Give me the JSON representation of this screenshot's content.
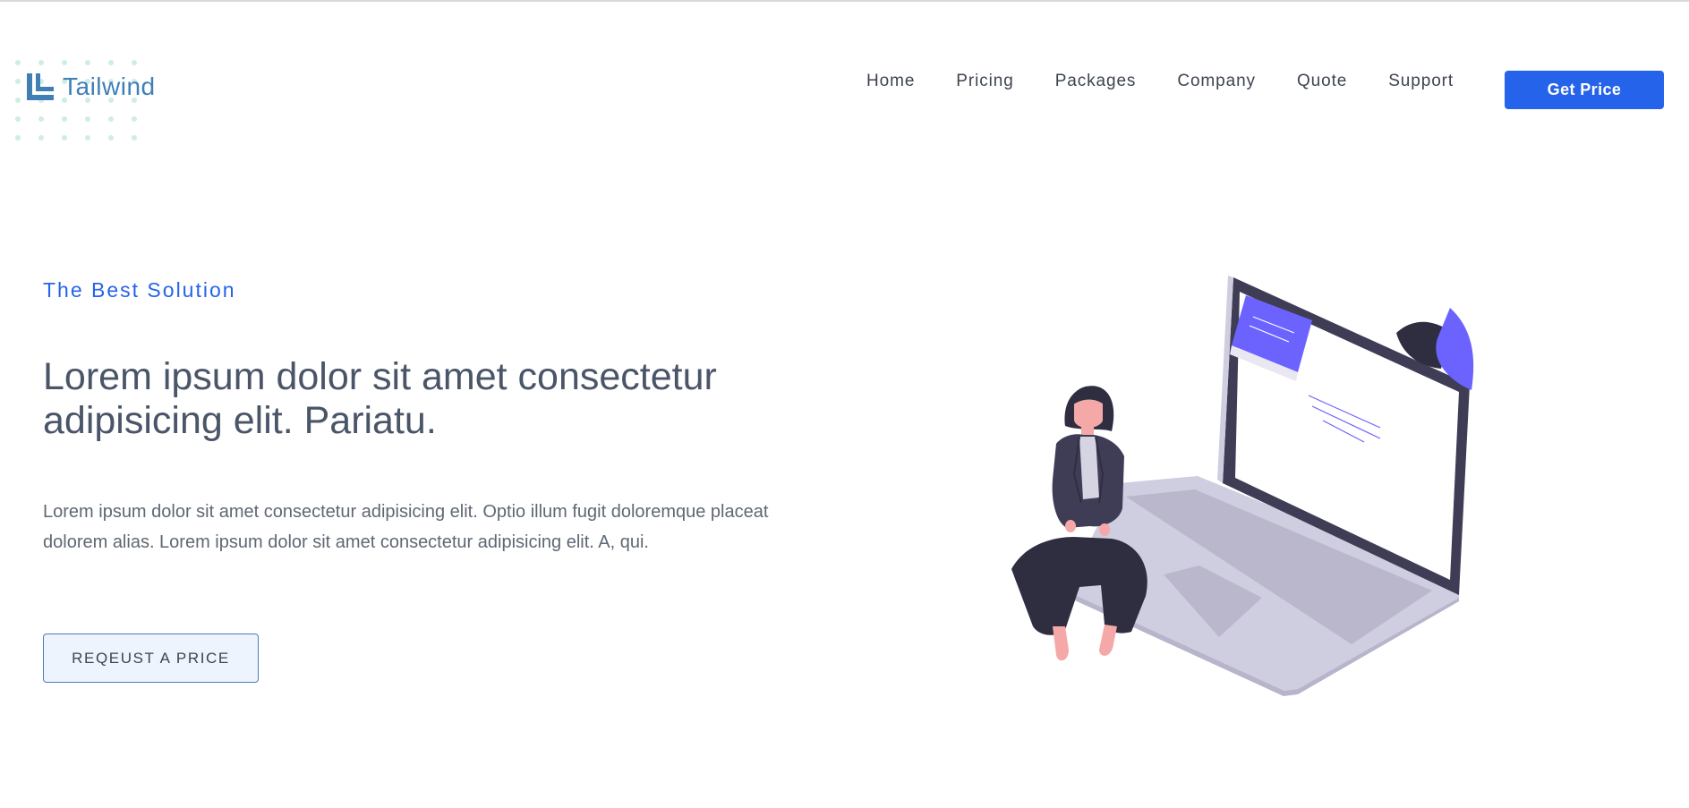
{
  "header": {
    "logo_text": "Tailwind",
    "nav": [
      {
        "label": "Home"
      },
      {
        "label": "Pricing"
      },
      {
        "label": "Packages"
      },
      {
        "label": "Company"
      },
      {
        "label": "Quote"
      },
      {
        "label": "Support"
      }
    ],
    "cta_label": "Get Price"
  },
  "hero": {
    "eyebrow": "The Best Solution",
    "headline_line1": "Lorem ipsum dolor sit amet consectetur",
    "headline_line2": "adipisicing elit. Pariatu.",
    "paragraph_line1": "Lorem ipsum dolor sit amet consectetur adipisicing elit. Optio illum fugit doloremque placeat",
    "paragraph_line2": "dolorem alias. Lorem ipsum dolor sit amet consectetur adipisicing elit. A, qui.",
    "cta_label": "REQEUST A PRICE"
  },
  "colors": {
    "primary": "#2563eb",
    "logo": "#3f7fb6",
    "text": "#4a5568",
    "illustration_accent": "#6c63ff",
    "laptop_body": "#cfcde0",
    "laptop_bezel": "#3f3d56"
  },
  "icons": [
    "logo-icon",
    "dot-pattern",
    "woman-laptop-illustration"
  ]
}
